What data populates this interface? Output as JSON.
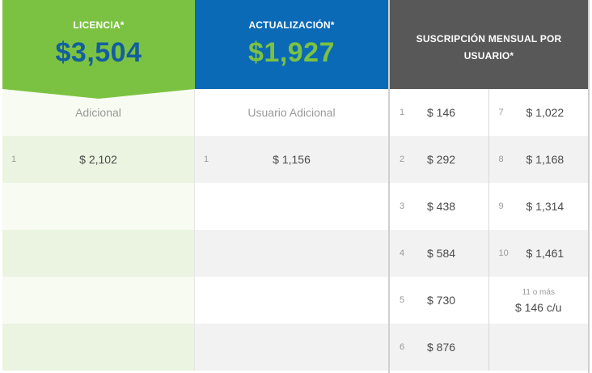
{
  "licencia": {
    "title": "LICENCIA*",
    "price": "$3,504",
    "subtitle": "Adicional",
    "additional": [
      {
        "idx": "1",
        "price": "$ 2,102"
      }
    ]
  },
  "actualizacion": {
    "title": "ACTUALIZACIÓN*",
    "price": "$1,927",
    "subtitle": "Usuario Adicional",
    "additional": [
      {
        "idx": "1",
        "price": "$ 1,156"
      }
    ]
  },
  "suscripcion": {
    "title": "SUSCRIPCIÓN MENSUAL POR USUARIO*",
    "left": [
      {
        "n": "1",
        "p": "$ 146"
      },
      {
        "n": "2",
        "p": "$ 292"
      },
      {
        "n": "3",
        "p": "$ 438"
      },
      {
        "n": "4",
        "p": "$ 584"
      },
      {
        "n": "5",
        "p": "$ 730"
      },
      {
        "n": "6",
        "p": "$ 876"
      }
    ],
    "right": [
      {
        "n": "7",
        "p": "$ 1,022"
      },
      {
        "n": "8",
        "p": "$ 1,168"
      },
      {
        "n": "9",
        "p": "$ 1,314"
      },
      {
        "n": "10",
        "p": "$ 1,461"
      }
    ],
    "more_label": "11 o más",
    "more_price": "$ 146 c/u"
  },
  "colors": {
    "green": "#7cc242",
    "blue": "#0a6ab6",
    "dark_blue_price": "#135f9e",
    "gray_header": "#585858"
  }
}
